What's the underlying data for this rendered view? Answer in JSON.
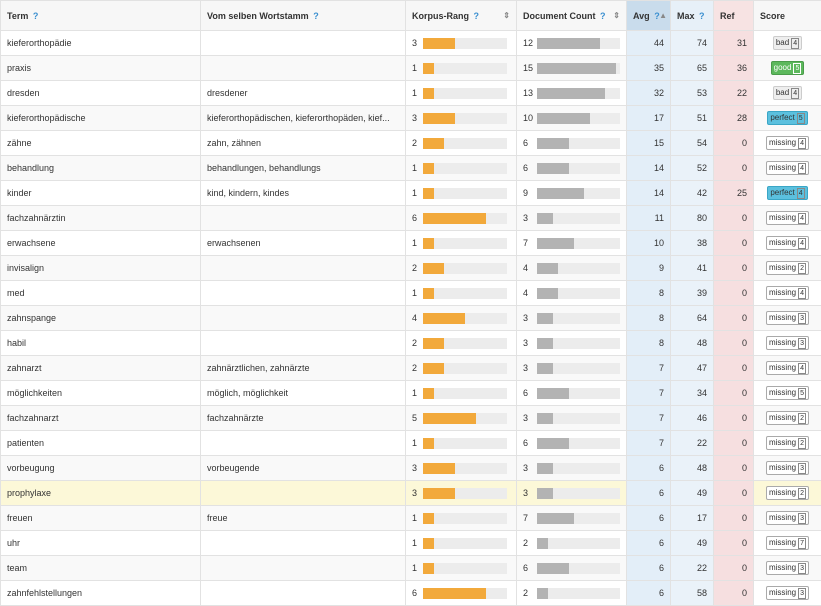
{
  "headers": {
    "term": "Term",
    "stem": "Vom selben Wortstamm",
    "rank": "Korpus-Rang",
    "docs": "Document Count",
    "avg": "Avg",
    "max": "Max",
    "ref": "Ref",
    "score": "Score",
    "help": "?",
    "sort_icon": "⇕",
    "sort_asc_icon": "▲"
  },
  "colors": {
    "rank_bar": "#f2a93b",
    "doc_bar": "#b3b3b3"
  },
  "scales": {
    "rank_max": 8,
    "doc_max": 16
  },
  "rows": [
    {
      "term": "kieferorthopädie",
      "stem": "",
      "rank": "3",
      "docs": "12",
      "avg": "44",
      "max": "74",
      "ref": "31",
      "score": "bad",
      "score_n": "4"
    },
    {
      "term": "praxis",
      "stem": "",
      "rank": "1",
      "docs": "15",
      "avg": "35",
      "max": "65",
      "ref": "36",
      "score": "good",
      "score_n": "5"
    },
    {
      "term": "dresden",
      "stem": "dresdener",
      "rank": "1",
      "docs": "13",
      "avg": "32",
      "max": "53",
      "ref": "22",
      "score": "bad",
      "score_n": "4"
    },
    {
      "term": "kieferorthopädische",
      "stem": "kieferorthopädischen, kieferorthopäden, kief...",
      "rank": "3",
      "docs": "10",
      "avg": "17",
      "max": "51",
      "ref": "28",
      "score": "perfect",
      "score_n": "5"
    },
    {
      "term": "zähne",
      "stem": "zahn, zähnen",
      "rank": "2",
      "docs": "6",
      "avg": "15",
      "max": "54",
      "ref": "0",
      "score": "missing",
      "score_n": "4"
    },
    {
      "term": "behandlung",
      "stem": "behandlungen, behandlungs",
      "rank": "1",
      "docs": "6",
      "avg": "14",
      "max": "52",
      "ref": "0",
      "score": "missing",
      "score_n": "4"
    },
    {
      "term": "kinder",
      "stem": "kind, kindern, kindes",
      "rank": "1",
      "docs": "9",
      "avg": "14",
      "max": "42",
      "ref": "25",
      "score": "perfect",
      "score_n": "4"
    },
    {
      "term": "fachzahnärztin",
      "stem": "",
      "rank": "6",
      "docs": "3",
      "avg": "11",
      "max": "80",
      "ref": "0",
      "score": "missing",
      "score_n": "4"
    },
    {
      "term": "erwachsene",
      "stem": "erwachsenen",
      "rank": "1",
      "docs": "7",
      "avg": "10",
      "max": "38",
      "ref": "0",
      "score": "missing",
      "score_n": "4"
    },
    {
      "term": "invisalign",
      "stem": "",
      "rank": "2",
      "docs": "4",
      "avg": "9",
      "max": "41",
      "ref": "0",
      "score": "missing",
      "score_n": "2"
    },
    {
      "term": "med",
      "stem": "",
      "rank": "1",
      "docs": "4",
      "avg": "8",
      "max": "39",
      "ref": "0",
      "score": "missing",
      "score_n": "4"
    },
    {
      "term": "zahnspange",
      "stem": "",
      "rank": "4",
      "docs": "3",
      "avg": "8",
      "max": "64",
      "ref": "0",
      "score": "missing",
      "score_n": "3"
    },
    {
      "term": "habil",
      "stem": "",
      "rank": "2",
      "docs": "3",
      "avg": "8",
      "max": "48",
      "ref": "0",
      "score": "missing",
      "score_n": "3"
    },
    {
      "term": "zahnarzt",
      "stem": "zahnärztlichen, zahnärzte",
      "rank": "2",
      "docs": "3",
      "avg": "7",
      "max": "47",
      "ref": "0",
      "score": "missing",
      "score_n": "4"
    },
    {
      "term": "möglichkeiten",
      "stem": "möglich, möglichkeit",
      "rank": "1",
      "docs": "6",
      "avg": "7",
      "max": "34",
      "ref": "0",
      "score": "missing",
      "score_n": "5"
    },
    {
      "term": "fachzahnarzt",
      "stem": "fachzahnärzte",
      "rank": "5",
      "docs": "3",
      "avg": "7",
      "max": "46",
      "ref": "0",
      "score": "missing",
      "score_n": "2"
    },
    {
      "term": "patienten",
      "stem": "",
      "rank": "1",
      "docs": "6",
      "avg": "7",
      "max": "22",
      "ref": "0",
      "score": "missing",
      "score_n": "2"
    },
    {
      "term": "vorbeugung",
      "stem": "vorbeugende",
      "rank": "3",
      "docs": "3",
      "avg": "6",
      "max": "48",
      "ref": "0",
      "score": "missing",
      "score_n": "3"
    },
    {
      "term": "prophylaxe",
      "stem": "",
      "rank": "3",
      "docs": "3",
      "avg": "6",
      "max": "49",
      "ref": "0",
      "score": "missing",
      "score_n": "2",
      "highlight": true
    },
    {
      "term": "freuen",
      "stem": "freue",
      "rank": "1",
      "docs": "7",
      "avg": "6",
      "max": "17",
      "ref": "0",
      "score": "missing",
      "score_n": "3"
    },
    {
      "term": "uhr",
      "stem": "",
      "rank": "1",
      "docs": "2",
      "avg": "6",
      "max": "49",
      "ref": "0",
      "score": "missing",
      "score_n": "7"
    },
    {
      "term": "team",
      "stem": "",
      "rank": "1",
      "docs": "6",
      "avg": "6",
      "max": "22",
      "ref": "0",
      "score": "missing",
      "score_n": "3"
    },
    {
      "term": "zahnfehlstellungen",
      "stem": "",
      "rank": "6",
      "docs": "2",
      "avg": "6",
      "max": "58",
      "ref": "0",
      "score": "missing",
      "score_n": "3"
    }
  ]
}
